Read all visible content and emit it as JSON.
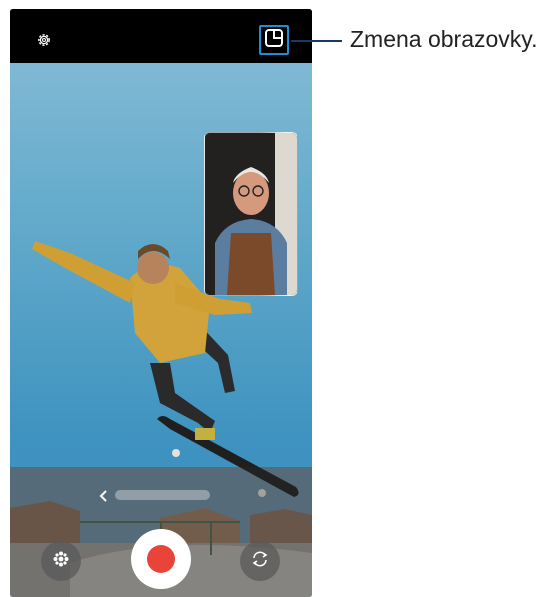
{
  "callout": {
    "text": "Zmena obrazovky."
  },
  "icons": {
    "settings": "gear-icon",
    "screen_switch": "screen-layout-icon",
    "mode_prev": "chevron-left-icon",
    "effects": "effect-icon",
    "record": "record-icon",
    "flip_camera": "camera-flip-icon"
  },
  "colors": {
    "highlight": "#1b8fd6",
    "record": "#e8443a",
    "callout_line": "#1a3a66"
  }
}
